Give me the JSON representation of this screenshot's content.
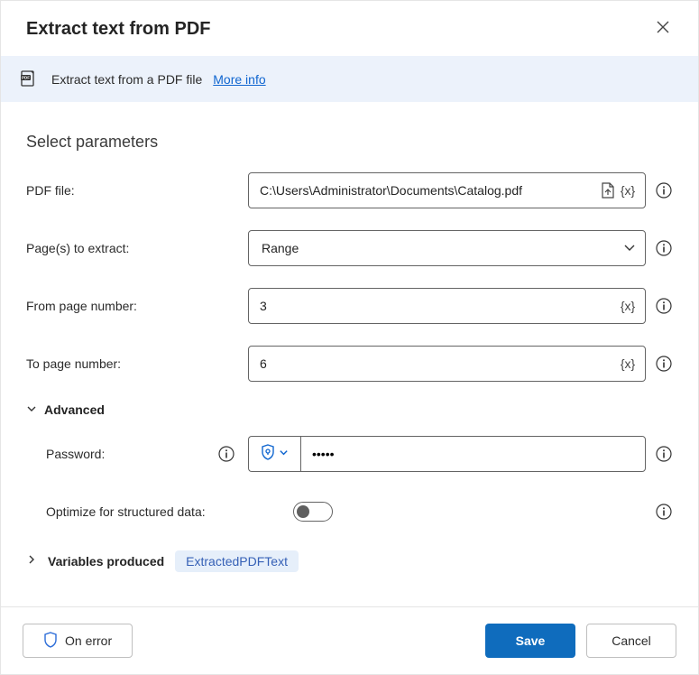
{
  "title": "Extract text from PDF",
  "banner": {
    "description": "Extract text from a PDF file",
    "link_text": "More info"
  },
  "section_title": "Select parameters",
  "fields": {
    "pdf_file": {
      "label": "PDF file:",
      "value": "C:\\Users\\Administrator\\Documents\\Catalog.pdf"
    },
    "pages_to_extract": {
      "label": "Page(s) to extract:",
      "value": "Range"
    },
    "from_page": {
      "label": "From page number:",
      "value": "3"
    },
    "to_page": {
      "label": "To page number:",
      "value": "6"
    }
  },
  "advanced": {
    "label": "Advanced",
    "password": {
      "label": "Password:",
      "value": "•••••"
    },
    "optimize": {
      "label": "Optimize for structured data:",
      "value": false
    }
  },
  "variables_produced": {
    "label": "Variables produced",
    "items": [
      "ExtractedPDFText"
    ]
  },
  "footer": {
    "on_error": "On error",
    "save": "Save",
    "cancel": "Cancel"
  },
  "chevron_right": "›",
  "var_token": "{x}"
}
